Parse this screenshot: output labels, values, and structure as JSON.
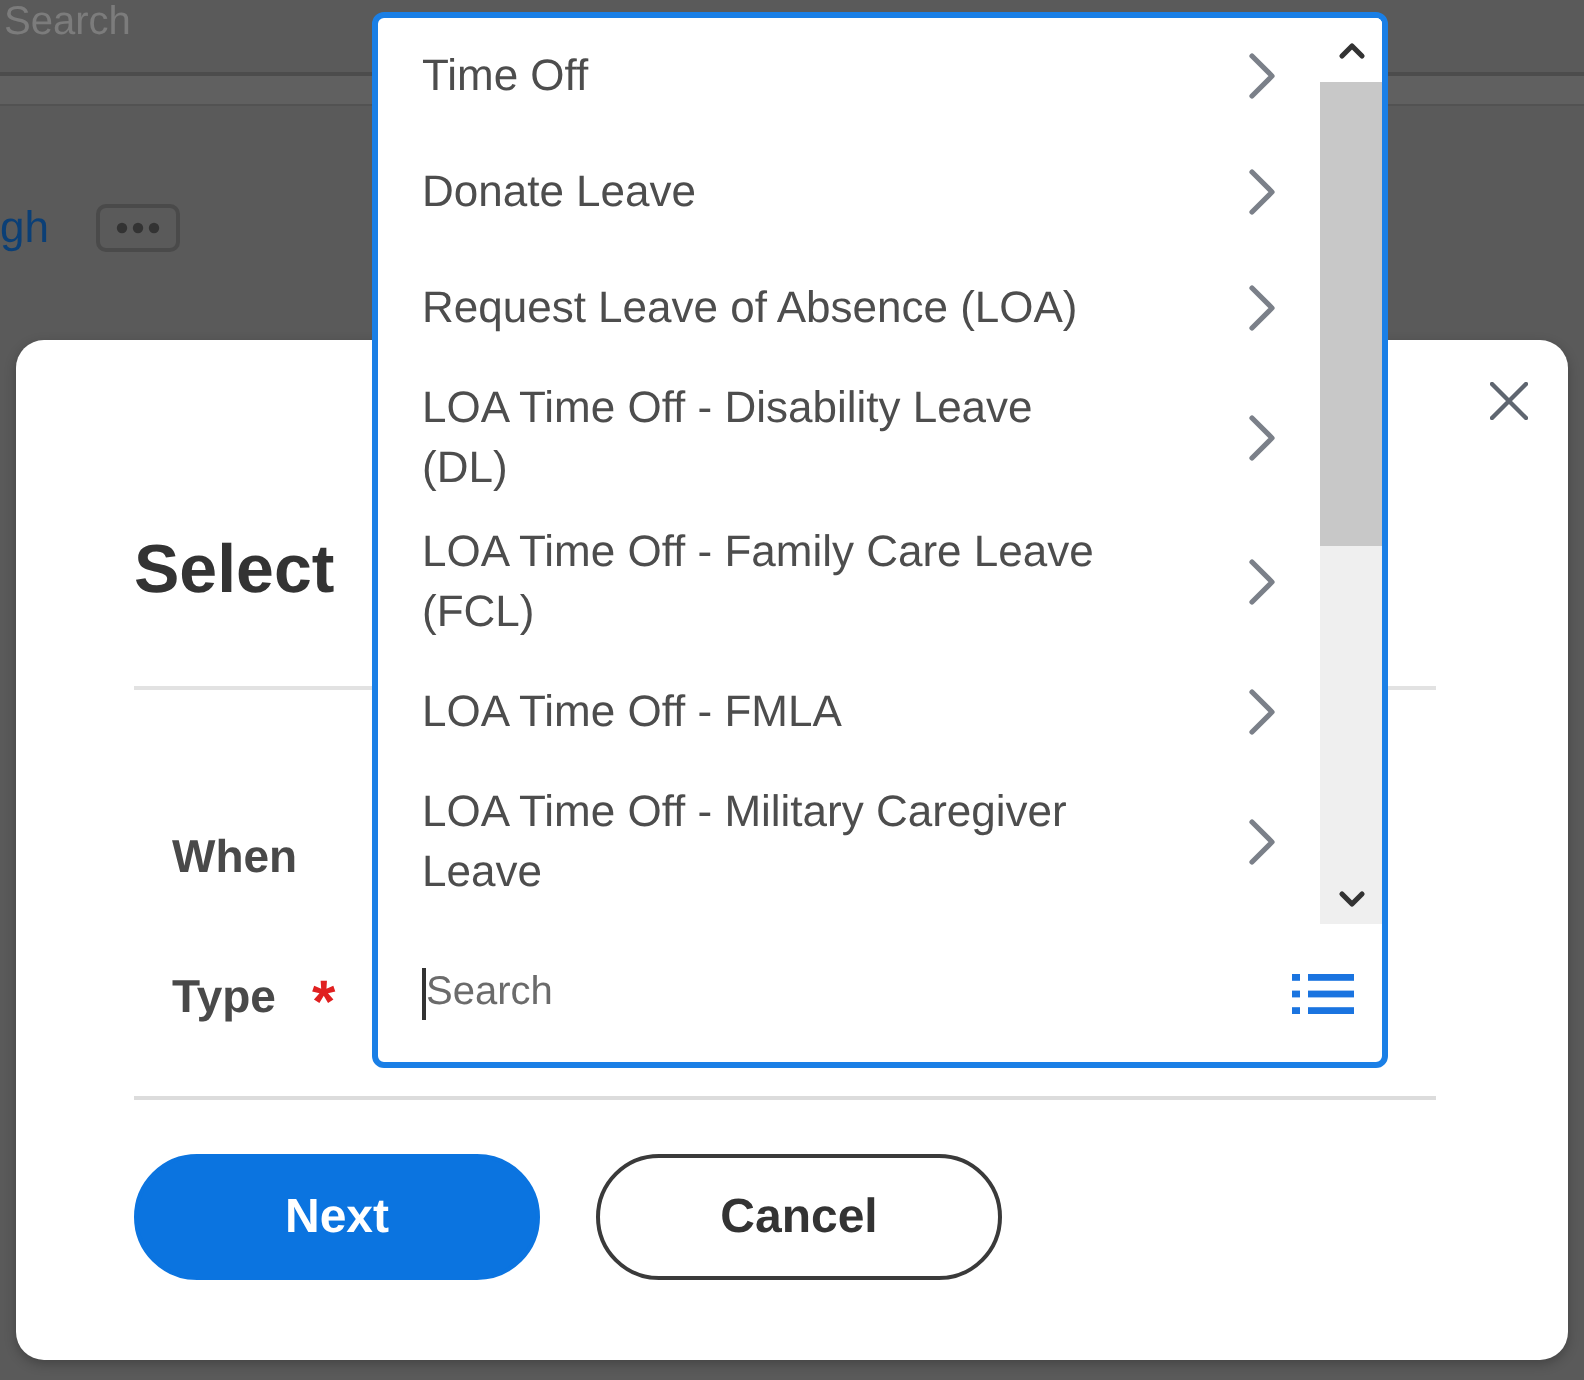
{
  "background_page": {
    "search_text": "Search",
    "link_text": "gh"
  },
  "dialog": {
    "title": "Select",
    "fields": [
      {
        "label": "When"
      },
      {
        "label": "Type",
        "required_mark": "*"
      }
    ],
    "buttons": [
      {
        "label": "Next",
        "kind": "primary"
      },
      {
        "label": "Cancel",
        "kind": "secondary"
      }
    ]
  },
  "dropdown": {
    "items": [
      {
        "label": "Time Off"
      },
      {
        "label": "Donate Leave"
      },
      {
        "label": "Request Leave of Absence (LOA)"
      },
      {
        "label": "LOA Time Off - Disability Leave (DL)"
      },
      {
        "label": "LOA Time Off - Family Care Leave (FCL)"
      },
      {
        "label": "LOA Time Off - FMLA"
      },
      {
        "label": "LOA Time Off - Military Caregiver Leave"
      }
    ],
    "search": {
      "placeholder": "Search",
      "focused": true
    }
  }
}
